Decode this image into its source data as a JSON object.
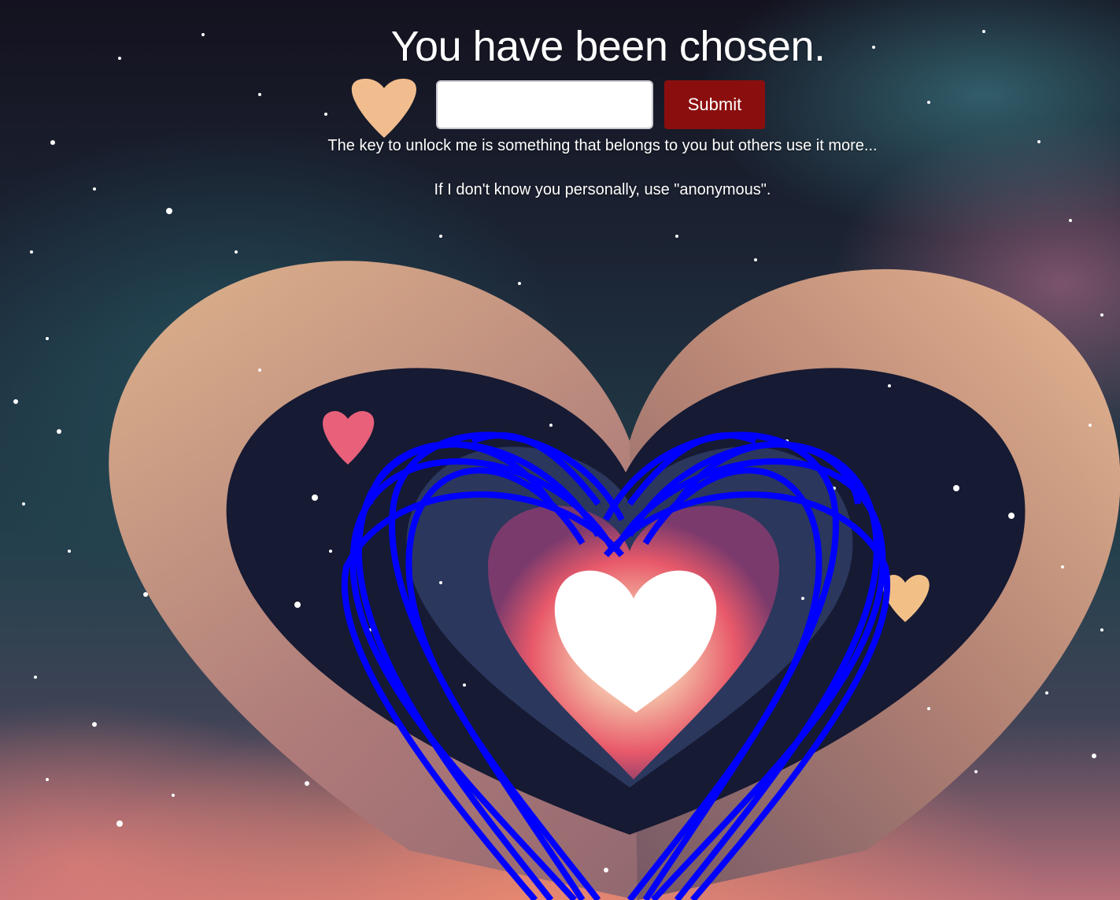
{
  "page": {
    "title": "You have been chosen.",
    "key_input": {
      "value": "",
      "placeholder": ""
    },
    "submit_label": "Submit",
    "hint_primary": "The key to unlock me is something that belongs to you but others use it more...",
    "hint_secondary": "If I don't know you personally, use \"anonymous\"."
  },
  "colors": {
    "submit_background": "#8b0e0e",
    "spiral_heart": "#0000ff",
    "text": "#ffffff"
  },
  "background": {
    "description_icon": "cosmic-heart-artwork"
  }
}
